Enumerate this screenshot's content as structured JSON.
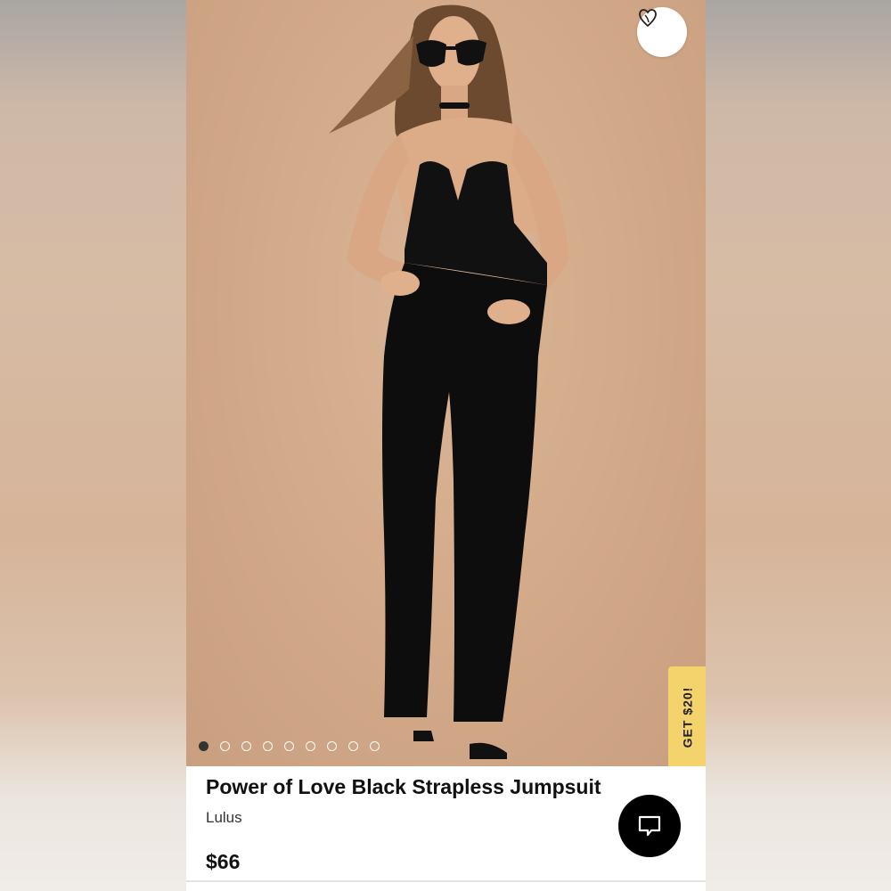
{
  "product": {
    "title": "Power of Love Black Strapless Jumpsuit",
    "brand": "Lulus",
    "price": "$66"
  },
  "gallery": {
    "image_count": 9,
    "active_index": 0
  },
  "promo": {
    "label": "GET $20!"
  },
  "icons": {
    "favorite": "heart-icon",
    "chat": "chat-bubble-icon"
  },
  "colors": {
    "promo_background": "#f5d36c",
    "chat_button": "#000000",
    "photo_background": "#d2a988"
  }
}
